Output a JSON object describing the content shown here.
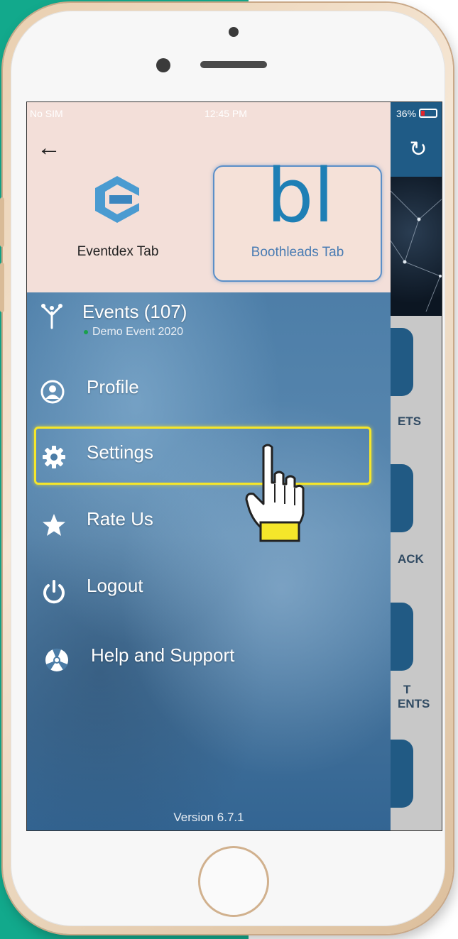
{
  "status_bar": {
    "carrier": "No SIM",
    "time": "12:45 PM",
    "battery": "36%"
  },
  "drawer": {
    "tabs": [
      {
        "label": "Eventdex Tab",
        "icon": "eventdex-logo-icon"
      },
      {
        "label": "Boothleads Tab",
        "logo_text": "bl"
      }
    ],
    "events": {
      "label": "Events (107)",
      "current": "Demo Event 2020"
    },
    "menu": [
      {
        "label": "Profile",
        "icon": "profile-icon"
      },
      {
        "label": "Settings",
        "icon": "gear-icon"
      },
      {
        "label": "Rate Us",
        "icon": "star-icon"
      },
      {
        "label": "Logout",
        "icon": "power-icon"
      },
      {
        "label": "Help and Support",
        "icon": "lifebuoy-icon"
      }
    ],
    "version": "Version 6.7.1"
  },
  "background_app": {
    "labels": [
      "ETS",
      "ACK",
      "T",
      "ENTS"
    ]
  },
  "colors": {
    "highlight": "#f5e62a",
    "brand_blue": "#1e7fb5",
    "page_green": "#12a98c"
  }
}
